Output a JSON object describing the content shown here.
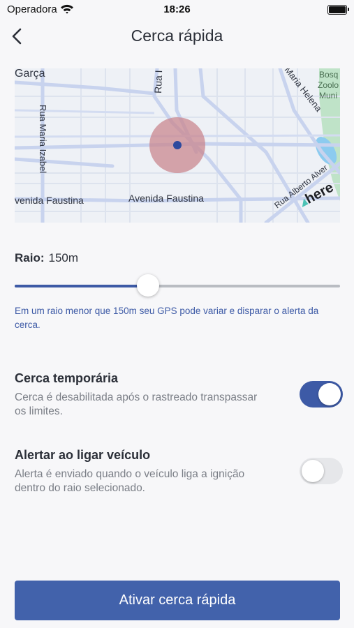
{
  "status_bar": {
    "carrier": "Operadora",
    "time": "18:26",
    "wifi_icon": "wifi-icon",
    "battery_icon": "battery-icon"
  },
  "header": {
    "title": "Cerca rápida",
    "back_icon": "chevron-left-icon"
  },
  "map": {
    "labels": {
      "garca": "Garça",
      "rua_i": "Rua I",
      "maria_helena": "Maria Helena",
      "bosque": "Bosq",
      "zoologico": "Zoolo",
      "municipal": "Muni",
      "rua_maria_izabel": "Rua Maria Izabel",
      "avenida_faustina_left": "venida Faustina",
      "avenida_faustina_center": "Avenida Faustina",
      "rua_alberto": "Rua Alberto Alver",
      "here_logo": "here"
    },
    "fence_color": "#c9878f",
    "marker_color": "#2e4a9e"
  },
  "radius": {
    "label": "Raio:",
    "value": "150m",
    "fraction": 0.41
  },
  "radius_hint": "Em um raio menor que 150m seu GPS pode variar e disparar o alerta da cerca.",
  "temporary_fence": {
    "title": "Cerca temporária",
    "description": "Cerca é desabilitada após o rastreado transpassar os limites.",
    "enabled": true
  },
  "vehicle_alert": {
    "title": "Alertar ao ligar veículo",
    "description": "Alerta é enviado quando o veículo liga a ignição dentro do raio selecionado.",
    "enabled": false
  },
  "primary_action": {
    "label": "Ativar cerca rápida"
  },
  "colors": {
    "accent": "#3d5aa6",
    "button": "#4262ab",
    "background": "#f7f7f9"
  }
}
